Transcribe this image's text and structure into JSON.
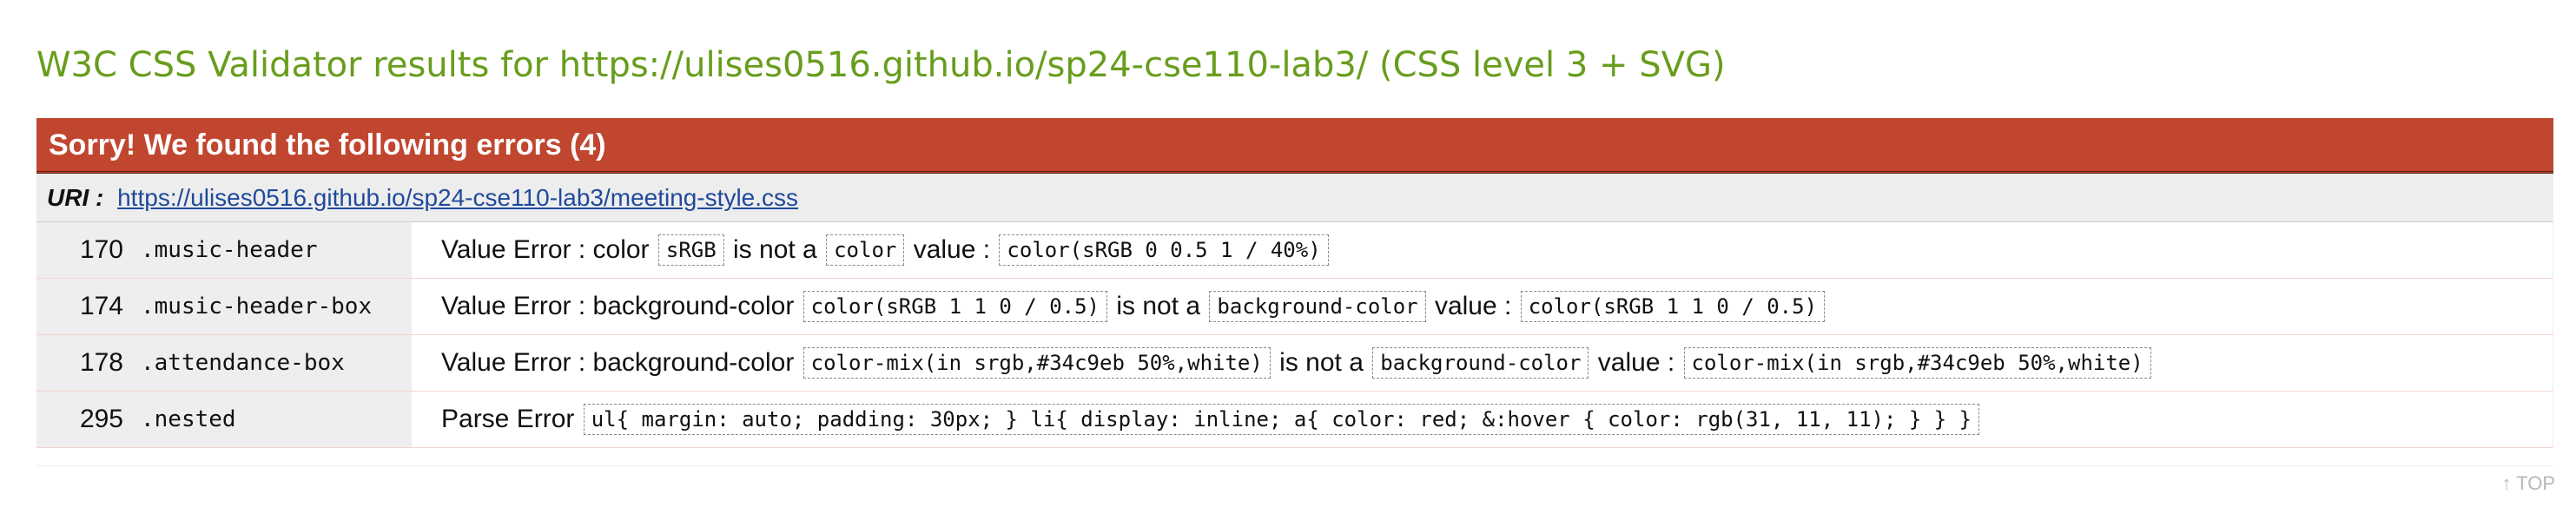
{
  "page": {
    "title": "W3C CSS Validator results for https://ulises0516.github.io/sp24-cse110-lab3/ (CSS level 3 + SVG)",
    "top_link": "↑ TOP"
  },
  "errors": {
    "header": "Sorry! We found the following errors (4)",
    "uri_label": "URI :",
    "uri": "https://ulises0516.github.io/sp24-cse110-lab3/meeting-style.css",
    "rows": [
      {
        "line": "170",
        "selector": ".music-header",
        "type": "Value Error : color",
        "found": "sRGB",
        "mid": "is not a",
        "expected": "color",
        "value_label": "value :",
        "value": "color(sRGB 0 0.5 1 / 40%)"
      },
      {
        "line": "174",
        "selector": ".music-header-box",
        "type": "Value Error : background-color",
        "found": "color(sRGB 1 1 0 / 0.5)",
        "mid": "is not a",
        "expected": "background-color",
        "value_label": "value :",
        "value": "color(sRGB 1 1 0 / 0.5)"
      },
      {
        "line": "178",
        "selector": ".attendance-box",
        "type": "Value Error : background-color",
        "found": "color-mix(in srgb,#34c9eb 50%,white)",
        "mid": "is not a",
        "expected": "background-color",
        "value_label": "value :",
        "value": "color-mix(in srgb,#34c9eb 50%,white)"
      },
      {
        "line": "295",
        "selector": ".nested",
        "type": "Parse Error",
        "found": "ul{ margin: auto; padding: 30px; } li{ display: inline; a{ color: red; &:hover { color: rgb(31, 11, 11); } } }"
      }
    ]
  },
  "colors": {
    "title_green": "#689d1d",
    "error_header_bg": "#c1462f",
    "link_blue": "#1f4a9c"
  }
}
